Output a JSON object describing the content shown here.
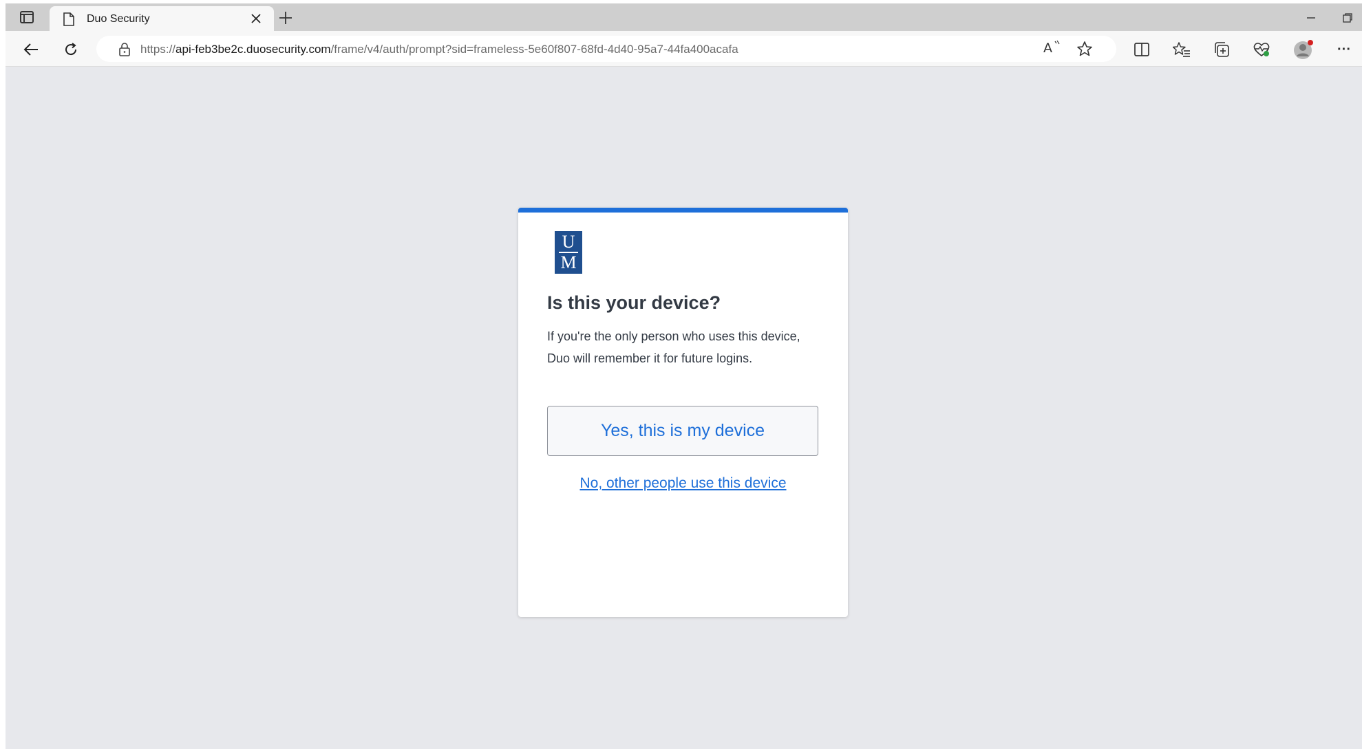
{
  "browser": {
    "tab_title": "Duo Security",
    "url_prefix": "https://",
    "url_host": "api-feb3be2c.duosecurity.com",
    "url_path": "/frame/v4/auth/prompt?sid=frameless-5e60f807-68fd-4d40-95a7-44fa400acafa",
    "read_aloud_label": "A",
    "more_label": "···"
  },
  "logo": {
    "top_letter": "U",
    "bottom_letter": "M"
  },
  "prompt": {
    "title": "Is this your device?",
    "description": "If you're the only person who uses this device, Duo will remember it for future logins.",
    "yes_label": "Yes, this is my device",
    "no_label": "No, other people use this device"
  },
  "colors": {
    "accent": "#1e6fd9",
    "logo": "#1f4f8f",
    "background": "#e7e8ec"
  }
}
